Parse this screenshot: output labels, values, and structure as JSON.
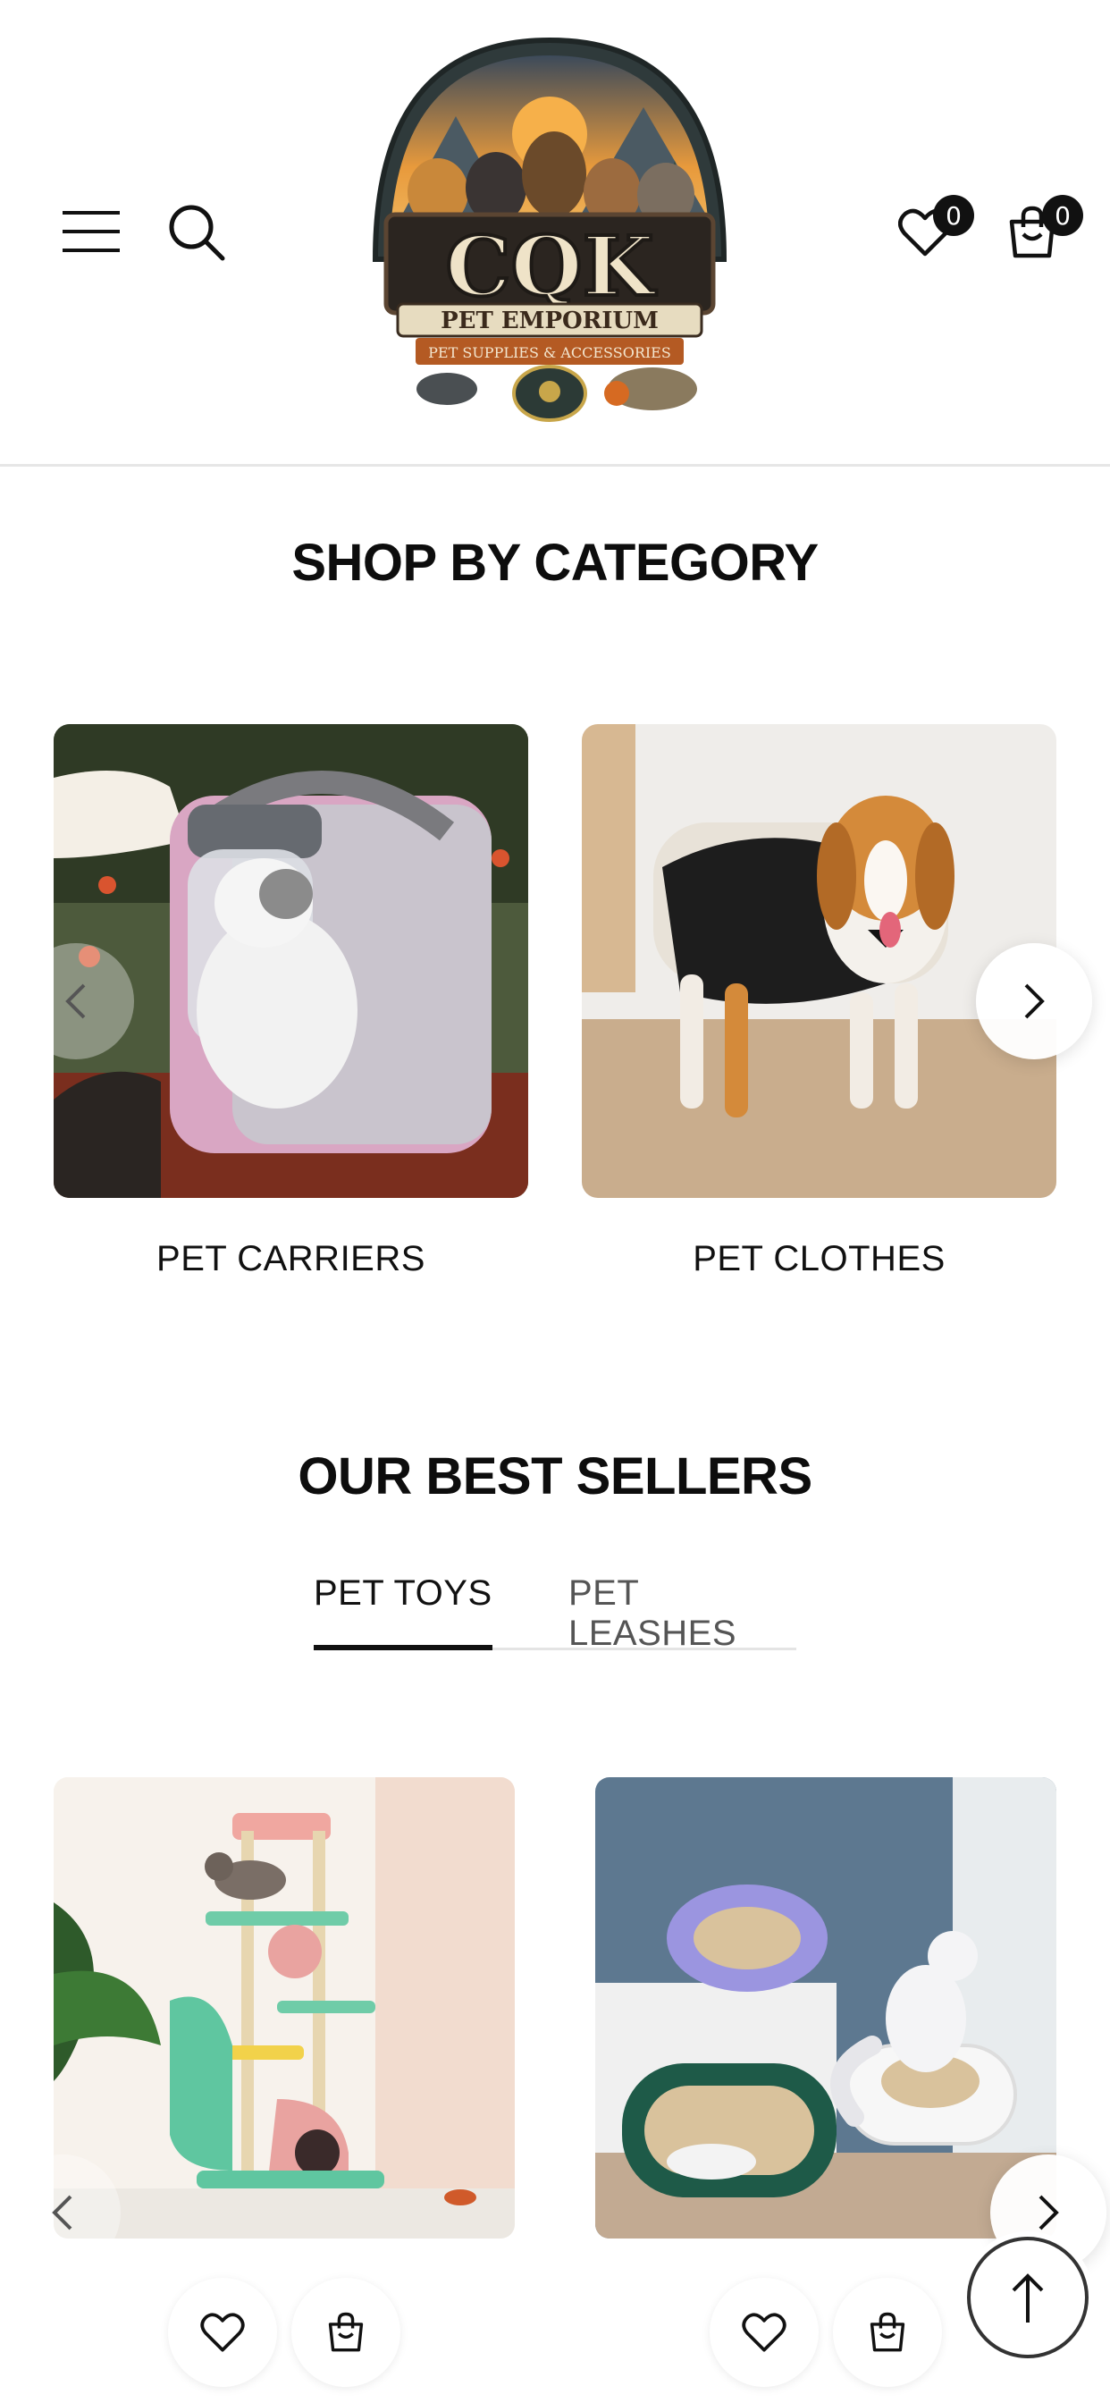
{
  "header": {
    "wishlist_count": "0",
    "cart_count": "0",
    "logo": {
      "brand": "CQK",
      "subtitle": "PET EMPORIUM",
      "tagline": "PET SUPPLIES & ACCESSORIES"
    }
  },
  "categories": {
    "title": "SHOP BY CATEGORY",
    "items": [
      {
        "label": "PET CARRIERS"
      },
      {
        "label": "PET CLOTHES"
      }
    ]
  },
  "best_sellers": {
    "title": "OUR BEST SELLERS",
    "tabs": [
      {
        "label": "PET TOYS",
        "active": true
      },
      {
        "label": "PET LEASHES",
        "active": false
      }
    ]
  },
  "colors": {
    "text": "#111111",
    "badge": "#111111",
    "divider": "#e6e6e6"
  }
}
